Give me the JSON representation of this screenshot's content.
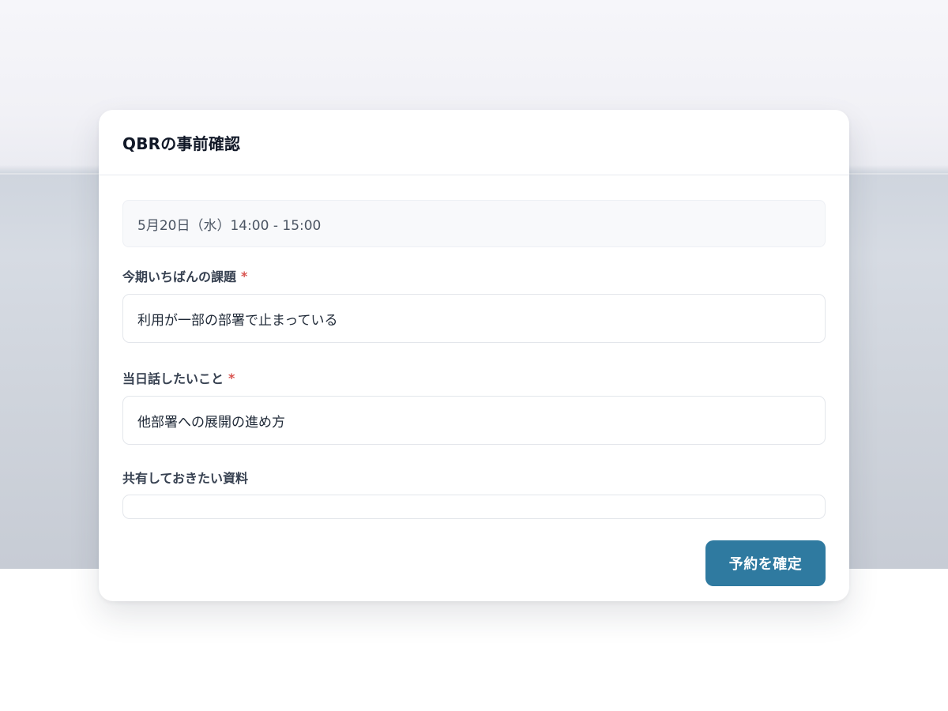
{
  "page": {
    "accent_color": "#2f7aa0",
    "required_color": "#d9534f"
  },
  "card": {
    "title": "QBRの事前確認",
    "datetime": "5月20日（水）14:00 - 15:00"
  },
  "form": {
    "fields": [
      {
        "label": "今期いちばんの課題",
        "required": true,
        "required_marker": "*",
        "value": "利用が一部の部署で止まっている"
      },
      {
        "label": "当日話したいこと",
        "required": true,
        "required_marker": "*",
        "value": "他部署への展開の進め方"
      },
      {
        "label": "共有しておきたい資料",
        "required": false,
        "value": ""
      }
    ],
    "submit_label": "予約を確定"
  }
}
